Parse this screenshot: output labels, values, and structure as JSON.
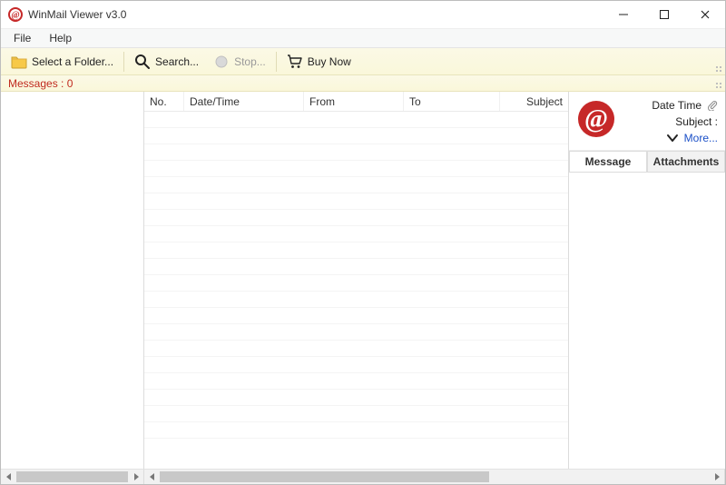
{
  "titlebar": {
    "title": "WinMail Viewer v3.0"
  },
  "menu": {
    "file": "File",
    "help": "Help"
  },
  "toolbar": {
    "select_folder": "Select a Folder...",
    "search": "Search...",
    "stop": "Stop...",
    "buy_now": "Buy Now"
  },
  "status": {
    "messages_label": "Messages : 0"
  },
  "columns": {
    "no": "No.",
    "datetime": "Date/Time",
    "from": "From",
    "to": "To",
    "subject": "Subject"
  },
  "preview": {
    "date_time": "Date Time",
    "subject_label": "Subject :",
    "more": "More...",
    "tab_message": "Message",
    "tab_attachments": "Attachments"
  },
  "colors": {
    "accent_red": "#c62828",
    "toolbar_bg": "#faf7da",
    "link": "#1a4fc7"
  }
}
